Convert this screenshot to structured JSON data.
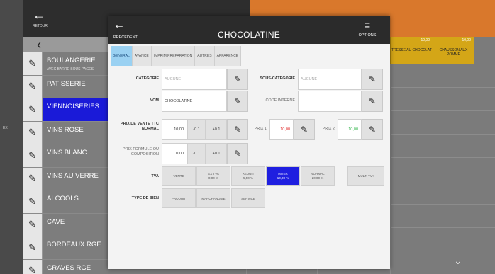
{
  "background": {
    "back_label": "RETOUR",
    "side_label": "EX",
    "categories": [
      {
        "name": "BOULANGERIE",
        "sub": "AVEC BARRE SOUS-PAGES",
        "active": false
      },
      {
        "name": "PATISSERIE",
        "sub": "",
        "active": false
      },
      {
        "name": "VIENNOISERIES",
        "sub": "",
        "active": true
      },
      {
        "name": "VINS ROSE",
        "sub": "",
        "active": false
      },
      {
        "name": "VINS BLANC",
        "sub": "",
        "active": false
      },
      {
        "name": "VINS AU VERRE",
        "sub": "",
        "active": false
      },
      {
        "name": "ALCOOLS",
        "sub": "",
        "active": false
      },
      {
        "name": "CAVE",
        "sub": "",
        "active": false
      },
      {
        "name": "BORDEAUX RGE",
        "sub": "",
        "active": false
      },
      {
        "name": "GRAVES RGE",
        "sub": "",
        "active": false
      }
    ],
    "products": [
      {
        "name": "TRESSE AU CHOCOLAT",
        "price": "10,00"
      },
      {
        "name": "CHAUSSON AUX POMME",
        "price": "10,00"
      }
    ]
  },
  "modal": {
    "back_label": "PRECEDENT",
    "title": "CHOCOLATINE",
    "options_label": "OPTIONS",
    "tabs": [
      "GENERAL",
      "AVANCE",
      "IMPRIM.PREPARATION",
      "AUTRES",
      "APPARENCE"
    ],
    "active_tab": "GENERAL",
    "categorie": {
      "label": "CATEGORIE",
      "value": "AUCUNE"
    },
    "sous_categorie": {
      "label": "SOUS-CATEGORIE",
      "value": "AUCUNE"
    },
    "nom": {
      "label": "NOM",
      "value": "CHOCOLATINE"
    },
    "code_interne": {
      "label": "CODE INTERNE",
      "value": ""
    },
    "prix_vente": {
      "label_1": "PRIX DE VENTE TTC",
      "label_2": "NORMAL",
      "value": "10,00",
      "minus": "-0.1",
      "plus": "+0.1"
    },
    "prix1": {
      "label": "PRIX 1",
      "value": "10,00"
    },
    "prix2": {
      "label": "PRIX 2",
      "value": "10,00"
    },
    "prix_formule": {
      "label_1": "PRIX FORMULE OU",
      "label_2": "COMPOSITION",
      "value": "0,00",
      "minus": "-0.1",
      "plus": "+0.1"
    },
    "tva": {
      "label": "TVA",
      "options": [
        {
          "line1": "VENTE",
          "line2": ""
        },
        {
          "line1": "EX TVA",
          "line2": "0,00 %"
        },
        {
          "line1": "REDUIT",
          "line2": "5,50 %"
        },
        {
          "line1": "INTER",
          "line2": "10,00 %"
        },
        {
          "line1": "NORMAL",
          "line2": "20,00 %"
        }
      ],
      "active_index": 3,
      "multi": "MULTI TVA"
    },
    "type_bien": {
      "label": "TYPE DE BIEN",
      "options": [
        "PRODUIT",
        "MARCHANDISE",
        "SERVICE"
      ]
    }
  }
}
